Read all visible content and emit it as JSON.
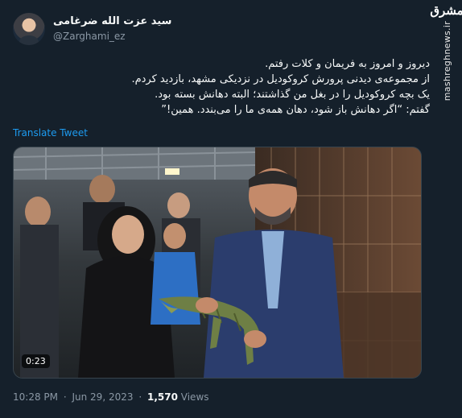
{
  "author": {
    "display_name": "سید عزت الله ضرغامی",
    "handle": "@Zarghami_ez"
  },
  "watermark": {
    "logo": "مشرق",
    "url": "mashreghnews.ir"
  },
  "tweet": {
    "lines": [
      "دیروز و امروز به فریمان و کلات رفتم.",
      "از مجموعه‌ی دیدنی پرورش کروکودیل در نزدیکی مشهد، بازدید کردم.",
      "یک بچه کروکودیل را در بغل من گذاشتند؛ البته دهانش بسته بود.",
      "گفتم: “اگر دهانش باز شود، دهان همه‌ی ما را می‌بندد. همین!”"
    ],
    "translate_label": "Translate Tweet"
  },
  "media": {
    "duration": "0:23"
  },
  "meta": {
    "time": "10:28 PM",
    "separator": "·",
    "date": "Jun 29, 2023",
    "views_count": "1,570",
    "views_label": "Views"
  }
}
